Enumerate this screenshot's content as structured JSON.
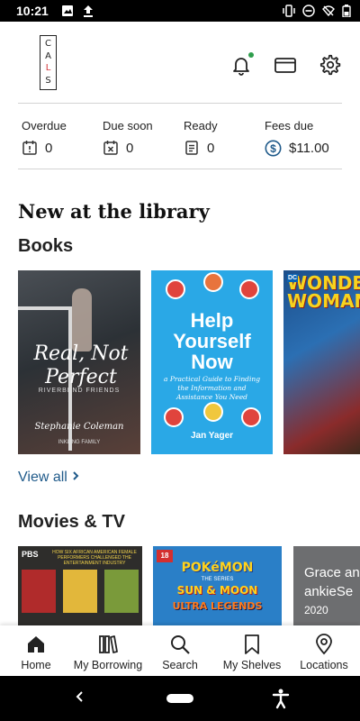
{
  "status_bar": {
    "time": "10:21"
  },
  "header": {
    "logo_letters": [
      "C",
      "A",
      "L",
      "S"
    ],
    "notification_dot_color": "#2e9e4c"
  },
  "stats": {
    "overdue": {
      "label": "Overdue",
      "value": "0",
      "icon": "calendar-alert-icon"
    },
    "due_soon": {
      "label": "Due soon",
      "value": "0",
      "icon": "calendar-x-icon"
    },
    "ready": {
      "label": "Ready",
      "value": "0",
      "icon": "document-icon"
    },
    "fees_due": {
      "label": "Fees due",
      "value": "$11.00",
      "icon": "dollar-circle-icon"
    }
  },
  "main": {
    "section_title": "New at the library",
    "books_title": "Books",
    "view_all": "View all",
    "movies_title": "Movies & TV"
  },
  "books": [
    {
      "title_line1": "Real, Not",
      "title_line2": "Perfect",
      "series": "RIVERBEND FRIENDS",
      "author": "Stephanie Coleman",
      "publisher": "INKLING FAMILY"
    },
    {
      "title_line1": "Help",
      "title_line2": "Yourself",
      "title_line3": "Now",
      "subtitle": "a Practical Guide to Finding the Information and Assistance You Need",
      "author": "Jan Yager"
    },
    {
      "title": "WONDER WOMAN",
      "badge": "DC"
    }
  ],
  "movies": [
    {
      "badge": "PBS",
      "caption": "HOW SIX AFRICAN AMERICAN FEMALE PERFORMERS CHALLENGED THE ENTERTAINMENT INDUSTRY"
    },
    {
      "rating": "18",
      "title": "POKéMON",
      "line2": "THE SERIES",
      "line3": "SUN & MOON",
      "line4": "ULTRA LEGENDS"
    },
    {
      "title_line1": "Grace an",
      "title_line2": "ankieSe",
      "year": "2020"
    }
  ],
  "bottom_nav": [
    {
      "label": "Home",
      "icon": "home-icon"
    },
    {
      "label": "My Borrowing",
      "icon": "books-icon"
    },
    {
      "label": "Search",
      "icon": "search-icon"
    },
    {
      "label": "My Shelves",
      "icon": "bookmark-icon"
    },
    {
      "label": "Locations",
      "icon": "location-pin-icon"
    }
  ],
  "colors": {
    "link": "#1f5a8a",
    "accent_red": "#d3343a",
    "fees_icon": "#1f5a8a"
  }
}
